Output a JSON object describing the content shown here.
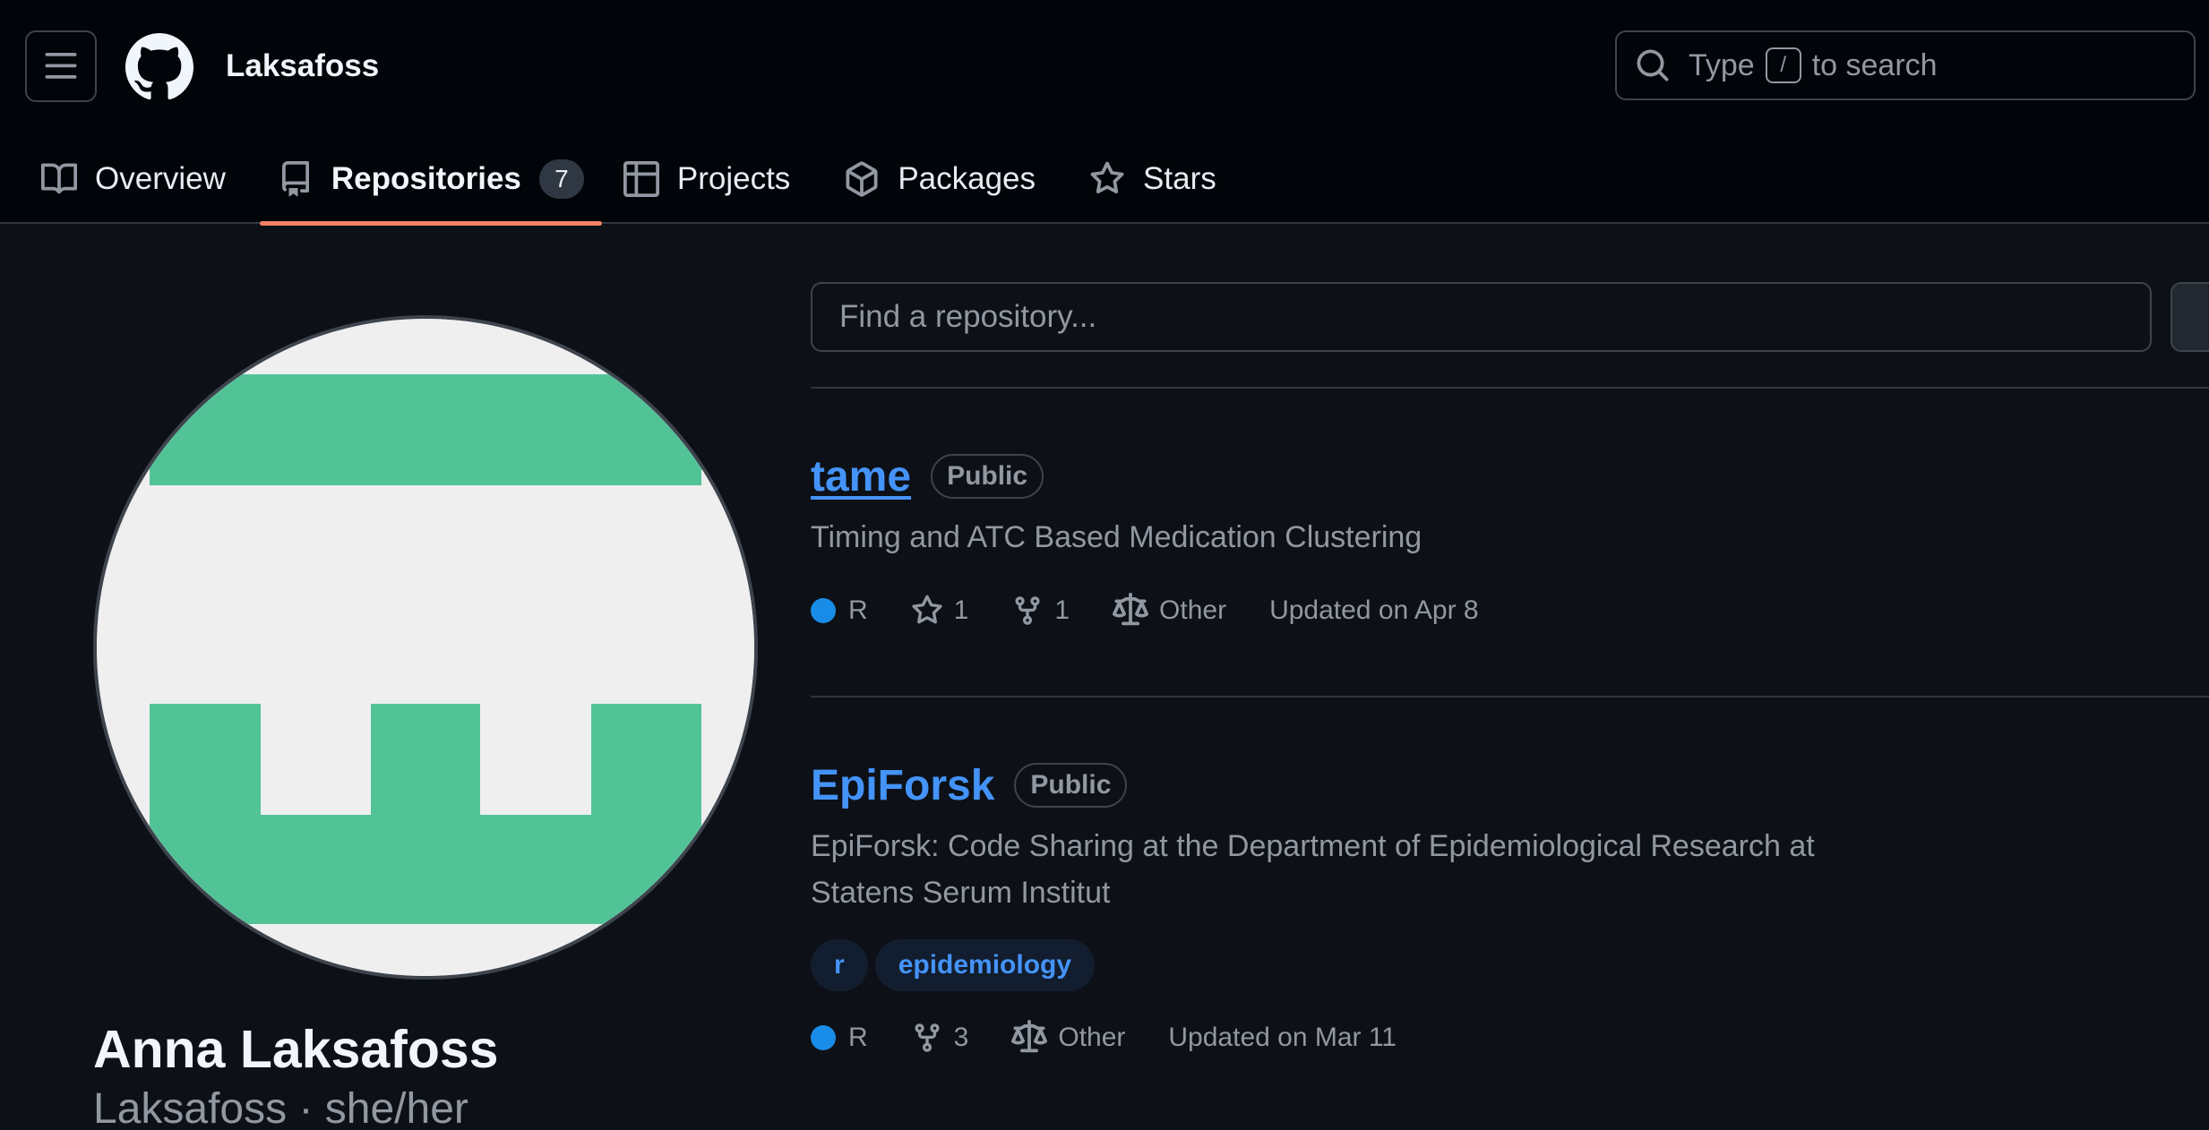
{
  "header": {
    "username": "Laksafoss",
    "search": {
      "prefix": "Type",
      "shortcut": "/",
      "suffix": "to search"
    }
  },
  "tabs": [
    {
      "label": "Overview",
      "icon": "book-icon"
    },
    {
      "label": "Repositories",
      "icon": "repo-icon",
      "count": "7",
      "active": true
    },
    {
      "label": "Projects",
      "icon": "table-icon"
    },
    {
      "label": "Packages",
      "icon": "package-icon"
    },
    {
      "label": "Stars",
      "icon": "star-icon"
    }
  ],
  "profile": {
    "name": "Anna Laksafoss",
    "handle": "Laksafoss · she/her",
    "avatar_colors": {
      "background": "#efefef",
      "foreground": "#52c397"
    }
  },
  "repo_search": {
    "placeholder": "Find a repository..."
  },
  "repos": [
    {
      "name": "tame",
      "visibility": "Public",
      "description": "Timing and ATC Based Medication Clustering",
      "language": "R",
      "language_color": "#198ce7",
      "stars": "1",
      "forks": "1",
      "license": "Other",
      "updated": "Updated on Apr 8"
    },
    {
      "name": "EpiForsk",
      "visibility": "Public",
      "description_line1": "EpiForsk: Code Sharing at the Department of Epidemiological Research at",
      "description_line2": "Statens Serum Institut",
      "topics": [
        "r",
        "epidemiology"
      ],
      "language": "R",
      "language_color": "#198ce7",
      "forks": "3",
      "license": "Other",
      "updated": "Updated on Mar 11"
    }
  ],
  "colors": {
    "accent_link": "#4493f8",
    "tab_underline": "#f78166",
    "header_bg": "#010409",
    "page_bg": "#0d1117"
  }
}
